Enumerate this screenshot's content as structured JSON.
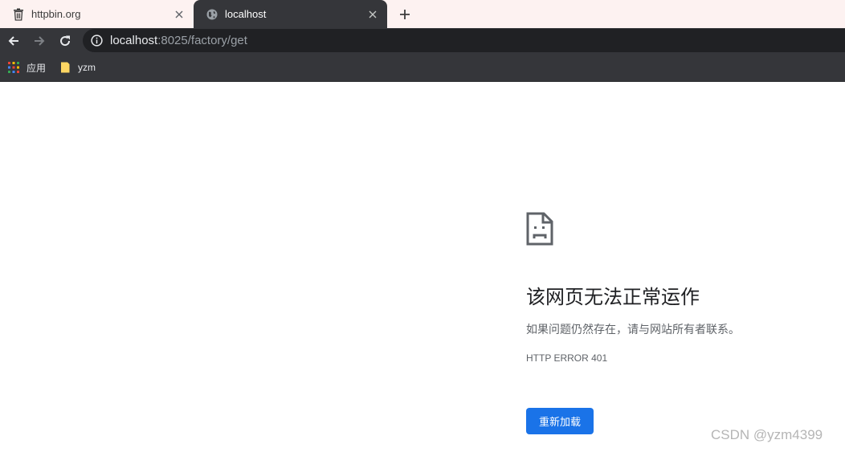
{
  "tabs": [
    {
      "title": "httpbin.org",
      "favicon": "trash-can-icon",
      "active": false
    },
    {
      "title": "localhost",
      "favicon": "globe-icon",
      "active": true
    }
  ],
  "toolbar": {
    "url_host": "localhost",
    "url_rest": ":8025/factory/get"
  },
  "bookmarks": {
    "items": [
      {
        "label": "应用",
        "icon": "apps-grid-icon"
      },
      {
        "label": "yzm",
        "icon": "folder-icon"
      }
    ]
  },
  "error": {
    "title": "该网页无法正常运作",
    "description": "如果问题仍然存在，请与网站所有者联系。",
    "code": "HTTP ERROR 401",
    "reload_label": "重新加载"
  },
  "watermark": "CSDN @yzm4399",
  "colors": {
    "tabstrip_bg": "#fdf2f1",
    "toolbar_bg": "#35363a",
    "omnibox_bg": "#202124",
    "accent": "#1a73e8"
  }
}
